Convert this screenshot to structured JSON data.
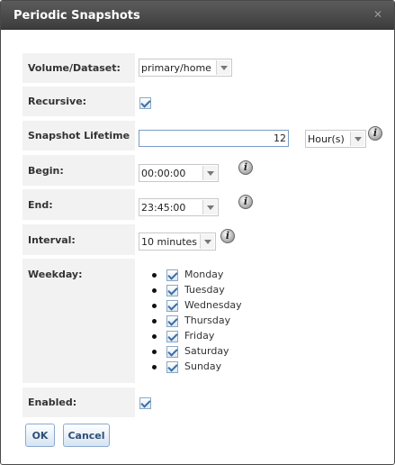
{
  "dialog": {
    "title": "Periodic Snapshots"
  },
  "fields": {
    "volume": {
      "label": "Volume/Dataset:",
      "value": "primary/home"
    },
    "recursive": {
      "label": "Recursive:",
      "checked": true
    },
    "lifetime": {
      "label": "Snapshot Lifetime",
      "value": "12",
      "unit": "Hour(s)"
    },
    "begin": {
      "label": "Begin:",
      "value": "00:00:00"
    },
    "end": {
      "label": "End:",
      "value": "23:45:00"
    },
    "interval": {
      "label": "Interval:",
      "value": "10 minutes"
    },
    "weekday": {
      "label": "Weekday:",
      "days": [
        {
          "name": "Monday",
          "checked": true
        },
        {
          "name": "Tuesday",
          "checked": true
        },
        {
          "name": "Wednesday",
          "checked": true
        },
        {
          "name": "Thursday",
          "checked": true
        },
        {
          "name": "Friday",
          "checked": true
        },
        {
          "name": "Saturday",
          "checked": true
        },
        {
          "name": "Sunday",
          "checked": true
        }
      ]
    },
    "enabled": {
      "label": "Enabled:",
      "checked": true
    }
  },
  "buttons": {
    "ok": "OK",
    "cancel": "Cancel"
  },
  "icons": {
    "info": "info-icon",
    "close": "close-icon",
    "dropdown": "chevron-down-icon",
    "check": "checkmark-icon"
  },
  "colors": {
    "titlebar": "#4a4a4a",
    "label_bg": "#f2f2f2",
    "button_text": "#2f4f75",
    "checkbox_border": "#8aa8c4"
  }
}
